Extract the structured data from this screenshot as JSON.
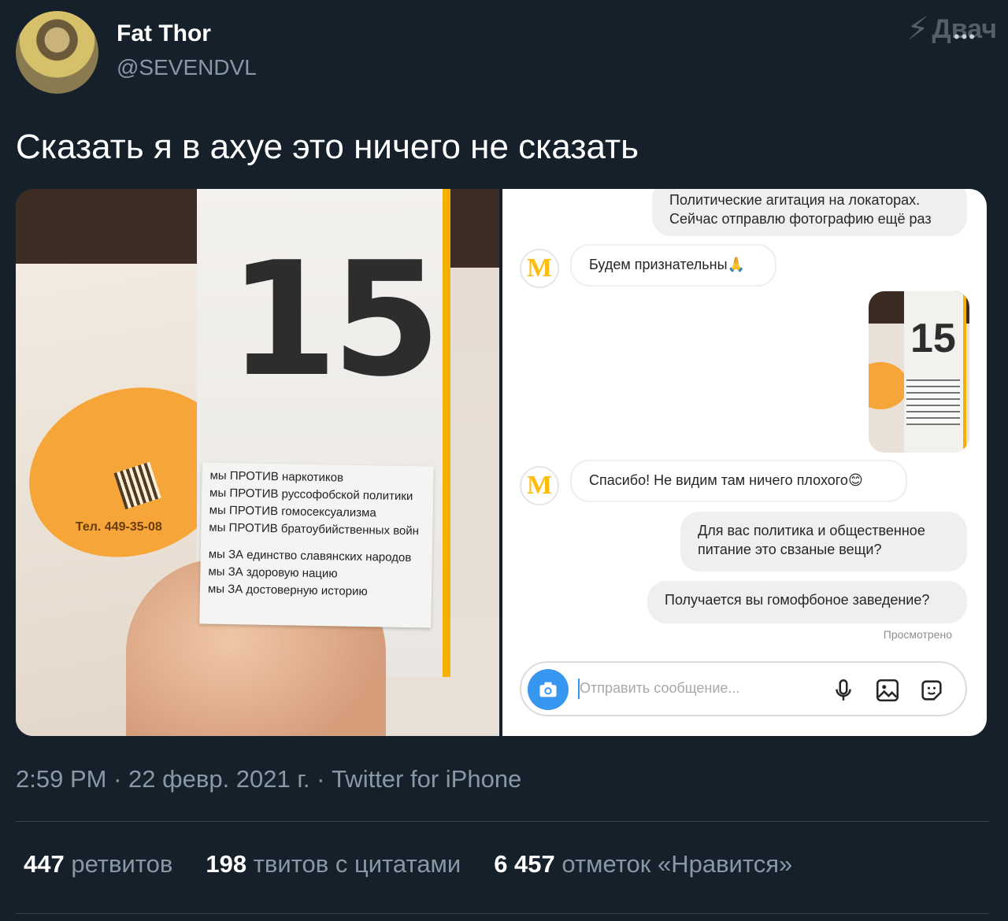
{
  "author": {
    "display_name": "Fat Thor",
    "handle": "@SEVENDVL"
  },
  "watermark": "Двач",
  "tweet": {
    "text": "Сказать я в ахуе это ничего не сказать"
  },
  "left_photo": {
    "card_number": "15",
    "sticker_phone": "Тел. 449-35-08",
    "note_lines_against": [
      "мы ПРОТИВ наркотиков",
      "мы ПРОТИВ руссофобской политики",
      "мы ПРОТИВ гомосексуализма",
      "мы ПРОТИВ братоубийственных войн"
    ],
    "note_lines_for": [
      "мы ЗА единство славянских народов",
      "мы ЗА здоровую нацию",
      "мы ЗА достоверную историю"
    ]
  },
  "chat": {
    "top_message_line1": "Политические агитация на локаторах.",
    "top_message_line2": "Сейчас отправлю фотографию ещё раз",
    "reply1": "Будем признательны🙏",
    "thumb_number": "15",
    "reply2": "Спасибо! Не видим там ничего плохого😊",
    "msg3_line1": "Для вас политика и общественное",
    "msg3_line2": "питание это свзаные вещи?",
    "msg4": "Получается вы гомофбоное заведение?",
    "seen_label": "Просмотрено",
    "composer_placeholder": "Отправить сообщение..."
  },
  "meta": {
    "time": "2:59 PM",
    "date": "22 февр. 2021 г.",
    "source": "Twitter for iPhone"
  },
  "stats": {
    "retweets_count": "447",
    "retweets_label": "ретвитов",
    "quotes_count": "198",
    "quotes_label": "твитов с цитатами",
    "likes_count": "6 457",
    "likes_label": "отметок «Нравится»"
  }
}
